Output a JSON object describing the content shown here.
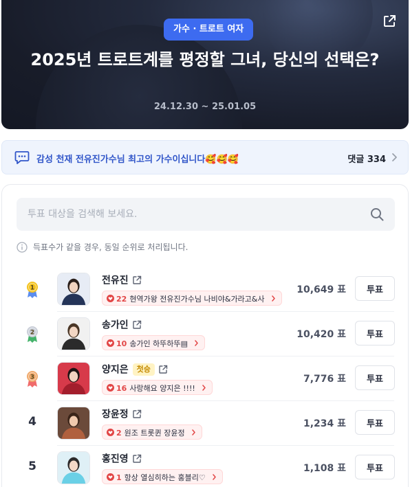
{
  "hero": {
    "category_badge": "가수 · 트로트 여자",
    "title": "2025년 트로트계를 평정할 그녀, 당신의 선택은?",
    "period": "24.12.30 ~ 25.01.05"
  },
  "comment_bar": {
    "message": "감성 천재 전유진가수님 최고의 가수이십니다🥰🥰🥰",
    "count_label": "댓글 334"
  },
  "search": {
    "placeholder": "투표 대상을 검색해 보세요."
  },
  "notice": "득표수가 같을 경우, 동일 순위로 처리됩니다.",
  "vote_button_label": "투표",
  "first_tag_label": "첫승",
  "colors": {
    "accent": "#3d6bf0",
    "heart": "#e24646",
    "gold": "#f4c21c",
    "silver": "#c9ced8",
    "bronze": "#f0a96b"
  },
  "rows": [
    {
      "rank": "1",
      "medal": "gold",
      "name": "전유진",
      "first_tag": false,
      "cheer_count": "22",
      "cheer_msg": "현역가왕 전유진가수님 나비야&가라고&사",
      "votes": "10,649 표"
    },
    {
      "rank": "2",
      "medal": "silver",
      "name": "송가인",
      "first_tag": false,
      "cheer_count": "10",
      "cheer_msg": "송가인 하뚜하뚜▤",
      "votes": "10,420 표"
    },
    {
      "rank": "3",
      "medal": "bronze",
      "name": "양지은",
      "first_tag": true,
      "cheer_count": "16",
      "cheer_msg": "사랑해요 양지은 !!!!",
      "votes": "7,776 표"
    },
    {
      "rank": "4",
      "medal": "",
      "name": "장윤정",
      "first_tag": false,
      "cheer_count": "2",
      "cheer_msg": "원조 트롯퀸 장윤정",
      "votes": "1,234 표"
    },
    {
      "rank": "5",
      "medal": "",
      "name": "홍진영",
      "first_tag": false,
      "cheer_count": "1",
      "cheer_msg": "항상 열심히하는 홍블리♡",
      "votes": "1,108 표"
    }
  ]
}
